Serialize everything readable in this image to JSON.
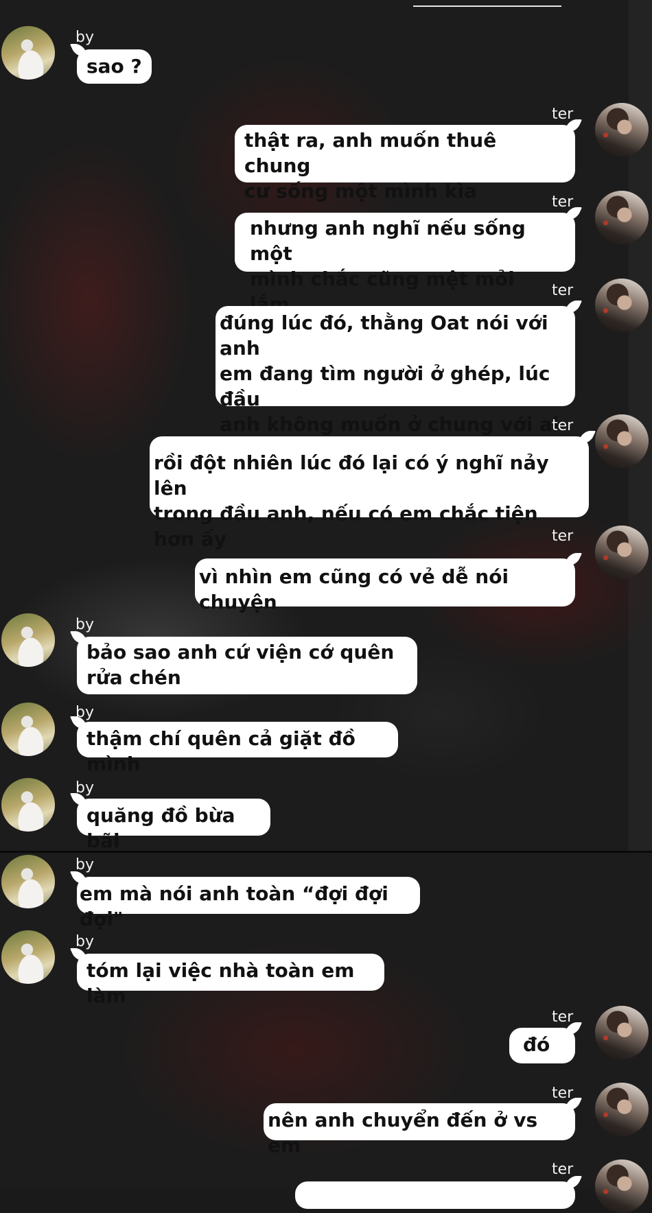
{
  "participants": {
    "by": {
      "name": "by"
    },
    "ter": {
      "name": "ter"
    }
  },
  "messages": [
    {
      "sender": "by",
      "text": "sao ?"
    },
    {
      "sender": "ter",
      "text": "thật ra, anh muốn thuê chung\ncư sống một mình kìa"
    },
    {
      "sender": "ter",
      "text": "nhưng anh nghĩ nếu sống một\nmình chắc cũng mệt mỏi lắm"
    },
    {
      "sender": "ter",
      "text": "đúng lúc đó, thằng Oat nói với anh\nem đang tìm người ở ghép, lúc đầu\nanh không muốn ở chung với ai"
    },
    {
      "sender": "ter",
      "text": "rồi đột nhiên lúc đó lại có ý nghĩ nảy lên\ntrong đầu anh, nếu có em chắc tiện hơn ấy"
    },
    {
      "sender": "ter",
      "text": "vì nhìn em cũng có vẻ dễ nói chuyện"
    },
    {
      "sender": "by",
      "text": "bảo sao anh cứ viện cớ quên\nrửa chén"
    },
    {
      "sender": "by",
      "text": "thậm chí quên cả giặt đồ mình"
    },
    {
      "sender": "by",
      "text": "quăng đồ bừa bãi"
    },
    {
      "sender": "by",
      "text": "em mà nói anh toàn “đợi đợi đợi\""
    },
    {
      "sender": "by",
      "text": "tóm lại việc nhà toàn em làm"
    },
    {
      "sender": "ter",
      "text": "đó"
    },
    {
      "sender": "ter",
      "text": "nên anh chuyển đến ở vs em"
    },
    {
      "sender": "ter",
      "text": ""
    }
  ]
}
